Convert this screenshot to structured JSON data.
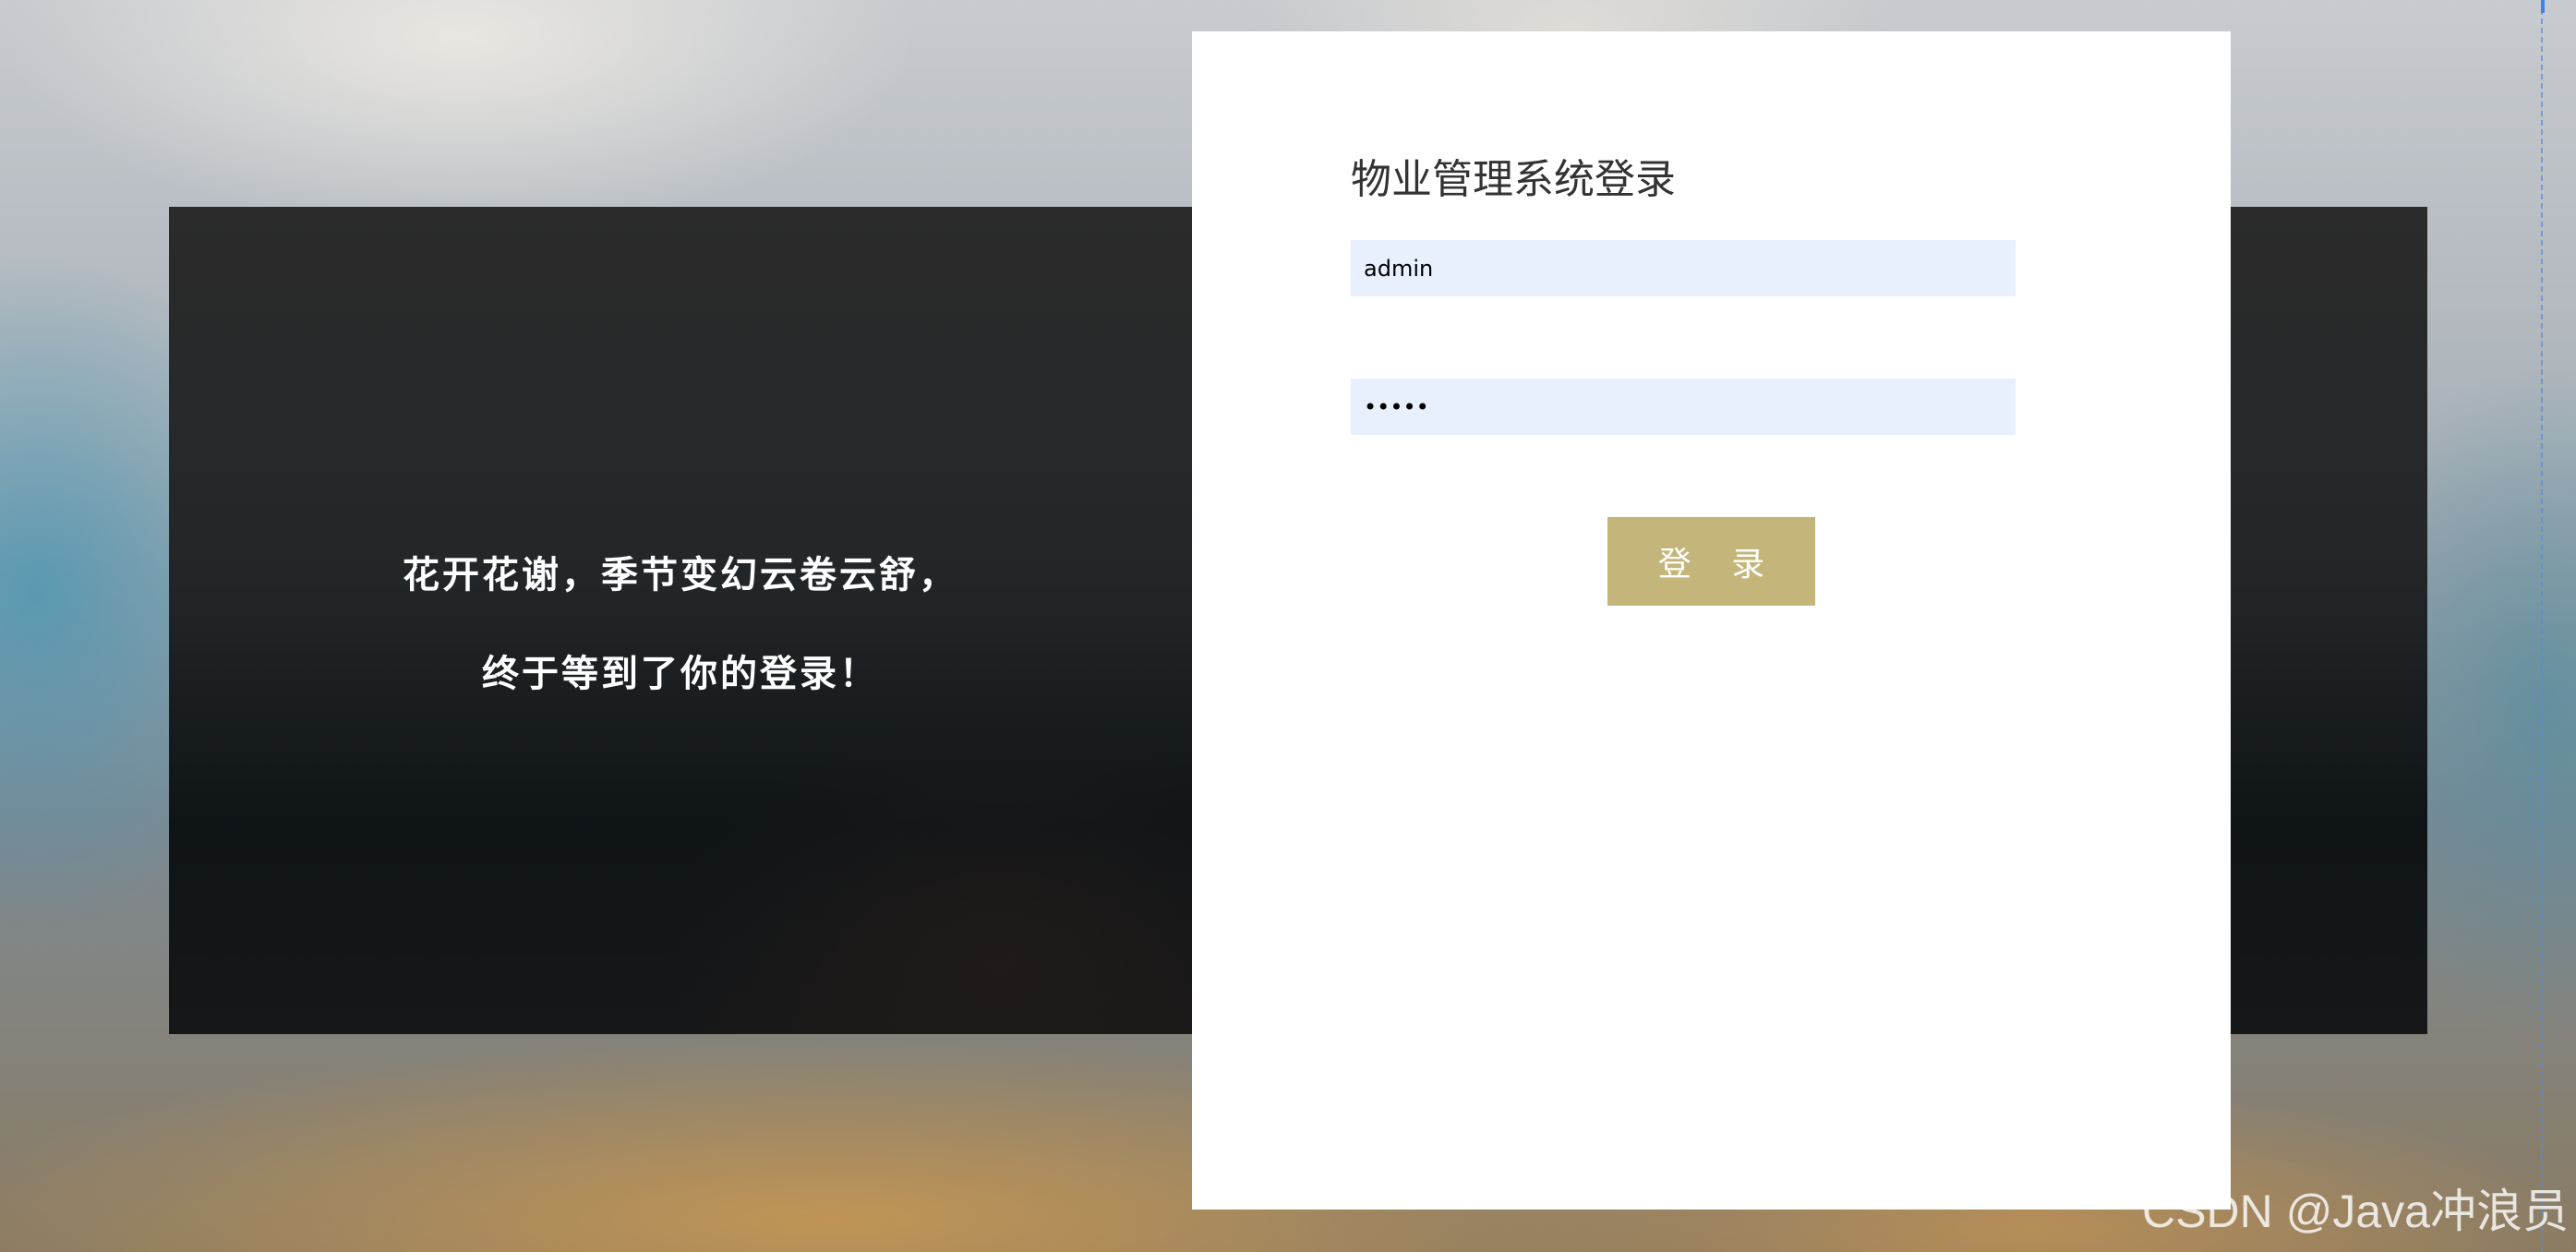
{
  "welcome": {
    "line1": "花开花谢，季节变幻云卷云舒，",
    "line2": "终于等到了你的登录！"
  },
  "login": {
    "title": "物业管理系统登录",
    "username_value": "admin",
    "password_value": "admin",
    "button_label": "登 录"
  },
  "watermark": "CSDN @Java冲浪员",
  "colors": {
    "button": "#c4b67a",
    "input_background": "#e8f0fe",
    "card": "#ffffff"
  }
}
